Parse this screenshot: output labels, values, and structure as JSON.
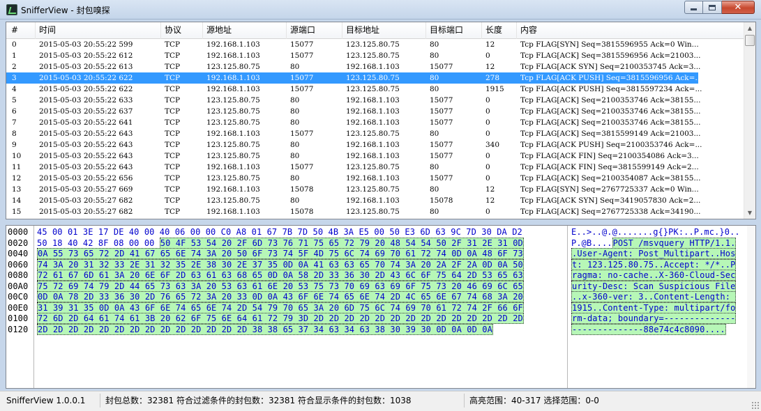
{
  "window": {
    "title": "SnifferView - 封包嗅探",
    "minimize_icon": "minimize-icon",
    "maximize_icon": "maximize-icon",
    "close_label": "✕"
  },
  "packet_list": {
    "columns": [
      "#",
      "时间",
      "协议",
      "源地址",
      "源端口",
      "目标地址",
      "目标端口",
      "长度",
      "内容"
    ],
    "selected_index": 3,
    "rows": [
      [
        "0",
        "2015-05-03 20:55:22 599",
        "TCP",
        "192.168.1.103",
        "15077",
        "123.125.80.75",
        "80",
        "12",
        "Tcp FLAG[SYN] Seq=3815596955 Ack=0 Win..."
      ],
      [
        "1",
        "2015-05-03 20:55:22 612",
        "TCP",
        "192.168.1.103",
        "15077",
        "123.125.80.75",
        "80",
        "0",
        "Tcp FLAG[ACK] Seq=3815596956 Ack=21003..."
      ],
      [
        "2",
        "2015-05-03 20:55:22 613",
        "TCP",
        "123.125.80.75",
        "80",
        "192.168.1.103",
        "15077",
        "12",
        "Tcp FLAG[ACK SYN] Seq=2100353745 Ack=3..."
      ],
      [
        "3",
        "2015-05-03 20:55:22 622",
        "TCP",
        "192.168.1.103",
        "15077",
        "123.125.80.75",
        "80",
        "278",
        "Tcp FLAG[ACK PUSH] Seq=3815596956 Ack=..."
      ],
      [
        "4",
        "2015-05-03 20:55:22 622",
        "TCP",
        "192.168.1.103",
        "15077",
        "123.125.80.75",
        "80",
        "1915",
        "Tcp FLAG[ACK PUSH] Seq=3815597234 Ack=..."
      ],
      [
        "5",
        "2015-05-03 20:55:22 633",
        "TCP",
        "123.125.80.75",
        "80",
        "192.168.1.103",
        "15077",
        "0",
        "Tcp FLAG[ACK] Seq=2100353746 Ack=38155..."
      ],
      [
        "6",
        "2015-05-03 20:55:22 637",
        "TCP",
        "123.125.80.75",
        "80",
        "192.168.1.103",
        "15077",
        "0",
        "Tcp FLAG[ACK] Seq=2100353746 Ack=38155..."
      ],
      [
        "7",
        "2015-05-03 20:55:22 641",
        "TCP",
        "123.125.80.75",
        "80",
        "192.168.1.103",
        "15077",
        "0",
        "Tcp FLAG[ACK] Seq=2100353746 Ack=38155..."
      ],
      [
        "8",
        "2015-05-03 20:55:22 643",
        "TCP",
        "192.168.1.103",
        "15077",
        "123.125.80.75",
        "80",
        "0",
        "Tcp FLAG[ACK] Seq=3815599149 Ack=21003..."
      ],
      [
        "9",
        "2015-05-03 20:55:22 643",
        "TCP",
        "123.125.80.75",
        "80",
        "192.168.1.103",
        "15077",
        "340",
        "Tcp FLAG[ACK PUSH] Seq=2100353746 Ack=..."
      ],
      [
        "10",
        "2015-05-03 20:55:22 643",
        "TCP",
        "123.125.80.75",
        "80",
        "192.168.1.103",
        "15077",
        "0",
        "Tcp FLAG[ACK FIN] Seq=2100354086 Ack=3..."
      ],
      [
        "11",
        "2015-05-03 20:55:22 643",
        "TCP",
        "192.168.1.103",
        "15077",
        "123.125.80.75",
        "80",
        "0",
        "Tcp FLAG[ACK FIN] Seq=3815599149 Ack=2..."
      ],
      [
        "12",
        "2015-05-03 20:55:22 656",
        "TCP",
        "123.125.80.75",
        "80",
        "192.168.1.103",
        "15077",
        "0",
        "Tcp FLAG[ACK] Seq=2100354087 Ack=38155..."
      ],
      [
        "13",
        "2015-05-03 20:55:27 669",
        "TCP",
        "192.168.1.103",
        "15078",
        "123.125.80.75",
        "80",
        "12",
        "Tcp FLAG[SYN] Seq=2767725337 Ack=0 Win..."
      ],
      [
        "14",
        "2015-05-03 20:55:27 682",
        "TCP",
        "123.125.80.75",
        "80",
        "192.168.1.103",
        "15078",
        "12",
        "Tcp FLAG[ACK SYN] Seq=3419057830 Ack=2..."
      ],
      [
        "15",
        "2015-05-03 20:55:27 682",
        "TCP",
        "192.168.1.103",
        "15078",
        "123.125.80.75",
        "80",
        "0",
        "Tcp FLAG[ACK] Seq=2767725338 Ack=34190..."
      ]
    ]
  },
  "hex_view": {
    "offsets": [
      "0000",
      "0020",
      "0040",
      "0060",
      "0080",
      "00A0",
      "00C0",
      "00E0",
      "0100",
      "0120"
    ],
    "lines": [
      {
        "plain": "45 00 01 3E 17 DE 40 00 40 06 00 00 C0 A8 01 67 7B 7D 50 4B 3A E5 00 50 E3 6D 63 9C 7D 30 DA D2",
        "hl": ""
      },
      {
        "plain": "50 18 40 42 8F 08 00 00 ",
        "hl": "50 4F 53 54 20 2F 6D 73 76 71 75 65 72 79 20 48 54 54 50 2F 31 2E 31 0D"
      },
      {
        "plain": "",
        "hl": "0A 55 73 65 72 2D 41 67 65 6E 74 3A 20 50 6F 73 74 5F 4D 75 6C 74 69 70 61 72 74 0D 0A 48 6F 73"
      },
      {
        "plain": "",
        "hl": "74 3A 20 31 32 33 2E 31 32 35 2E 38 30 2E 37 35 0D 0A 41 63 63 65 70 74 3A 20 2A 2F 2A 0D 0A 50"
      },
      {
        "plain": "",
        "hl": "72 61 67 6D 61 3A 20 6E 6F 2D 63 61 63 68 65 0D 0A 58 2D 33 36 30 2D 43 6C 6F 75 64 2D 53 65 63"
      },
      {
        "plain": "",
        "hl": "75 72 69 74 79 2D 44 65 73 63 3A 20 53 63 61 6E 20 53 75 73 70 69 63 69 6F 75 73 20 46 69 6C 65"
      },
      {
        "plain": "",
        "hl": "0D 0A 78 2D 33 36 30 2D 76 65 72 3A 20 33 0D 0A 43 6F 6E 74 65 6E 74 2D 4C 65 6E 67 74 68 3A 20"
      },
      {
        "plain": "",
        "hl": "31 39 31 35 0D 0A 43 6F 6E 74 65 6E 74 2D 54 79 70 65 3A 20 6D 75 6C 74 69 70 61 72 74 2F 66 6F"
      },
      {
        "plain": "",
        "hl": "72 6D 2D 64 61 74 61 3B 20 62 6F 75 6E 64 61 72 79 3D 2D 2D 2D 2D 2D 2D 2D 2D 2D 2D 2D 2D 2D 2D"
      },
      {
        "plain": "",
        "hl": "2D 2D 2D 2D 2D 2D 2D 2D 2D 2D 2D 2D 2D 2D 38 38 65 37 34 63 34 63 38 30 39 30 0D 0A 0D 0A"
      }
    ],
    "ascii": [
      {
        "plain": "E..>..@.@.......g{}PK:..P.mc.}0..",
        "hl": ""
      },
      {
        "plain": "P.@B....",
        "hl": "POST /msvquery HTTP/1.1."
      },
      {
        "plain": "",
        "hl": ".User-Agent: Post_Multipart..Hos"
      },
      {
        "plain": "",
        "hl": "t: 123.125.80.75..Accept: */*..P"
      },
      {
        "plain": "",
        "hl": "ragma: no-cache..X-360-Cloud-Sec"
      },
      {
        "plain": "",
        "hl": "urity-Desc: Scan Suspicious File"
      },
      {
        "plain": "",
        "hl": "..x-360-ver: 3..Content-Length: "
      },
      {
        "plain": "",
        "hl": "1915..Content-Type: multipart/fo"
      },
      {
        "plain": "",
        "hl": "rm-data; boundary=--------------"
      },
      {
        "plain": "",
        "hl": "--------------88e74c4c8090...."
      }
    ]
  },
  "statusbar": {
    "version": "SnifferView  1.0.0.1",
    "counts": "封包总数：32381  符合过滤条件的封包数：32381  符合显示条件的封包数：1038",
    "ranges": "高亮范围：40-317  选择范围：0-0"
  },
  "colors": {
    "selection": "#3399ff",
    "hex_text": "#0000cc",
    "highlight": "#b7f7b7"
  }
}
